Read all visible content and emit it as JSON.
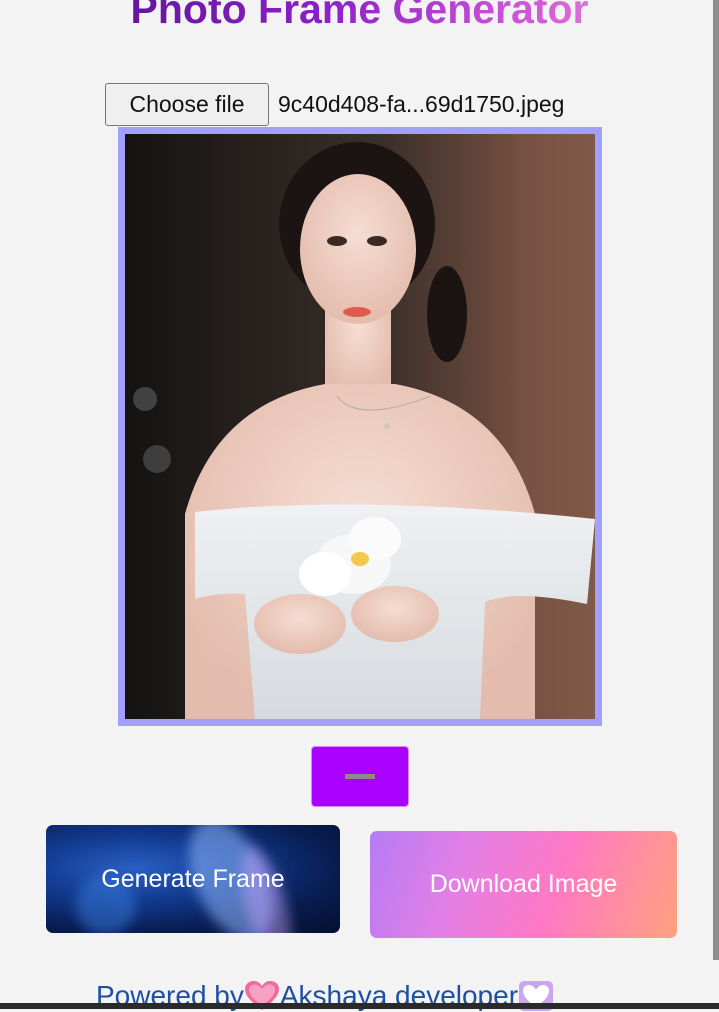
{
  "header": {
    "title": "Photo Frame Generator"
  },
  "file_input": {
    "button_label": "Choose file",
    "file_name": "9c40d408-fa...69d1750.jpeg"
  },
  "preview": {
    "frame_color": "#a3a0fb"
  },
  "toggle": {
    "icon": "minus-icon",
    "color": "#aa00ff"
  },
  "actions": {
    "generate_label": "Generate Frame",
    "download_label": "Download Image"
  },
  "footer": {
    "prefix": "Powered by ",
    "name": "Akshaya developer ",
    "heart_left_icon": "pink-heart-icon",
    "heart_right_icon": "white-heart-icon"
  }
}
